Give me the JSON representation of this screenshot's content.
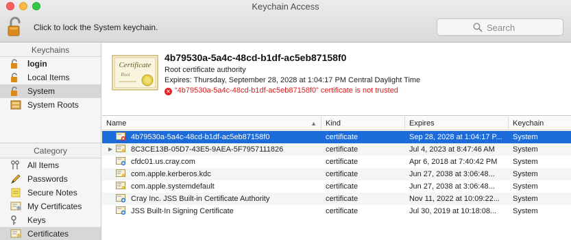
{
  "window": {
    "title": "Keychain Access",
    "lock_text": "Click to lock the System keychain.",
    "search_placeholder": "Search"
  },
  "sidebar": {
    "keychains_header": "Keychains",
    "keychains": [
      {
        "label": "login",
        "icon": "lock-open-icon",
        "bold": true
      },
      {
        "label": "Local Items",
        "icon": "lock-open-icon"
      },
      {
        "label": "System",
        "icon": "lock-open-icon",
        "selected": true
      },
      {
        "label": "System Roots",
        "icon": "cabinet-icon"
      }
    ],
    "category_header": "Category",
    "categories": [
      {
        "label": "All Items",
        "icon": "keys-icon"
      },
      {
        "label": "Passwords",
        "icon": "pencil-icon"
      },
      {
        "label": "Secure Notes",
        "icon": "note-icon"
      },
      {
        "label": "My Certificates",
        "icon": "my-certificate-icon"
      },
      {
        "label": "Keys",
        "icon": "key-icon"
      },
      {
        "label": "Certificates",
        "icon": "certificate-icon",
        "selected": true
      }
    ]
  },
  "detail": {
    "name": "4b79530a-5a4c-48cd-b1df-ac5eb87158f0",
    "type": "Root certificate authority",
    "expires": "Expires: Thursday, September 28, 2028 at 1:04:17 PM Central Daylight Time",
    "warning": "“4b79530a-5a4c-48cd-b1df-ac5eb87158f0” certificate is not trusted",
    "cert_image_label": "Certificate",
    "cert_image_sub": "Root"
  },
  "table": {
    "columns": [
      "Name",
      "Kind",
      "Expires",
      "Keychain"
    ],
    "rows": [
      {
        "name": "4b79530a-5a4c-48cd-b1df-ac5eb87158f0",
        "kind": "certificate",
        "expires": "Sep 28, 2028 at 1:04:17 P...",
        "keychain": "System",
        "icon": "untrusted-cert-icon",
        "selected": true
      },
      {
        "name": "8C3CE13B-05D7-43E5-9AEA-5F7957111826",
        "kind": "certificate",
        "expires": "Jul 4, 2023 at 8:47:46 AM",
        "keychain": "System",
        "icon": "certificate-icon",
        "disclosure": true
      },
      {
        "name": "cfdc01.us.cray.com",
        "kind": "certificate",
        "expires": "Apr 6, 2018 at 7:40:42 PM",
        "keychain": "System",
        "icon": "cert-plus-icon"
      },
      {
        "name": "com.apple.kerberos.kdc",
        "kind": "certificate",
        "expires": "Jun 27, 2038 at 3:06:48...",
        "keychain": "System",
        "icon": "certificate-icon"
      },
      {
        "name": "com.apple.systemdefault",
        "kind": "certificate",
        "expires": "Jun 27, 2038 at 3:06:48...",
        "keychain": "System",
        "icon": "certificate-icon"
      },
      {
        "name": "Cray Inc. JSS Built-in Certificate Authority",
        "kind": "certificate",
        "expires": "Nov 11, 2022 at 10:09:22...",
        "keychain": "System",
        "icon": "cert-plus-icon"
      },
      {
        "name": "JSS Built-In Signing Certificate",
        "kind": "certificate",
        "expires": "Jul 30, 2019 at 10:18:08...",
        "keychain": "System",
        "icon": "cert-plus-icon"
      }
    ]
  },
  "colors": {
    "selection": "#1b6bdb",
    "warning": "#d41c1c",
    "sidebar_selection": "#d7d7d7"
  }
}
